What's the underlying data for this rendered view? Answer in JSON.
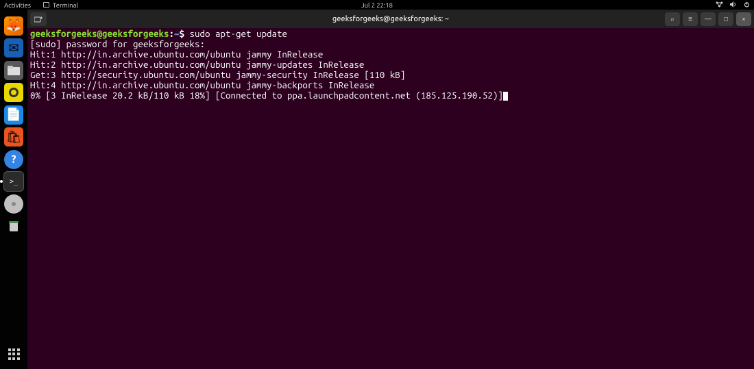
{
  "topbar": {
    "activities": "Activities",
    "app_icon": "terminal-icon",
    "app_name": "Terminal",
    "datetime": "Jul 2  22:18"
  },
  "dock": {
    "items": [
      {
        "name": "firefox",
        "bg": "linear-gradient(135deg,#ff9500,#e66000)",
        "glyph": "🦊"
      },
      {
        "name": "thunderbird",
        "bg": "#1b5fb4",
        "glyph": "✉"
      },
      {
        "name": "files",
        "bg": "#5a5a5a",
        "glyph": "📁"
      },
      {
        "name": "rhythmbox",
        "bg": "#e8d800",
        "glyph": "◉"
      },
      {
        "name": "libreoffice-writer",
        "bg": "#1e88e5",
        "glyph": "📄"
      },
      {
        "name": "software",
        "bg": "#e95420",
        "glyph": "🛍"
      },
      {
        "name": "help",
        "bg": "#3584e4",
        "glyph": "?"
      },
      {
        "name": "terminal",
        "bg": "#2b2b2b",
        "glyph": ">_",
        "active": true
      },
      {
        "name": "disc",
        "bg": "#c0c0c0",
        "glyph": "◉"
      },
      {
        "name": "trash",
        "bg": "#7a7a7a",
        "glyph": "🗑"
      }
    ],
    "apps_button": "show-applications"
  },
  "terminal": {
    "new_tab_label": "+",
    "title": "geeksforgeeks@geeksforgeeks: ~",
    "controls": {
      "search": "⌕",
      "menu": "≡",
      "minimize": "—",
      "maximize": "□",
      "close": "×"
    },
    "prompt": {
      "user": "geeksforgeeks@geeksforgeeks",
      "colon": ":",
      "path": "~",
      "symbol": "$ "
    },
    "command": "sudo apt-get update",
    "lines": [
      "[sudo] password for geeksforgeeks: ",
      "Hit:1 http://in.archive.ubuntu.com/ubuntu jammy InRelease",
      "Hit:2 http://in.archive.ubuntu.com/ubuntu jammy-updates InRelease",
      "Get:3 http://security.ubuntu.com/ubuntu jammy-security InRelease [110 kB]",
      "Hit:4 http://in.archive.ubuntu.com/ubuntu jammy-backports InRelease",
      "0% [3 InRelease 20.2 kB/110 kB 18%] [Connected to ppa.launchpadcontent.net (185.125.190.52)]"
    ]
  }
}
